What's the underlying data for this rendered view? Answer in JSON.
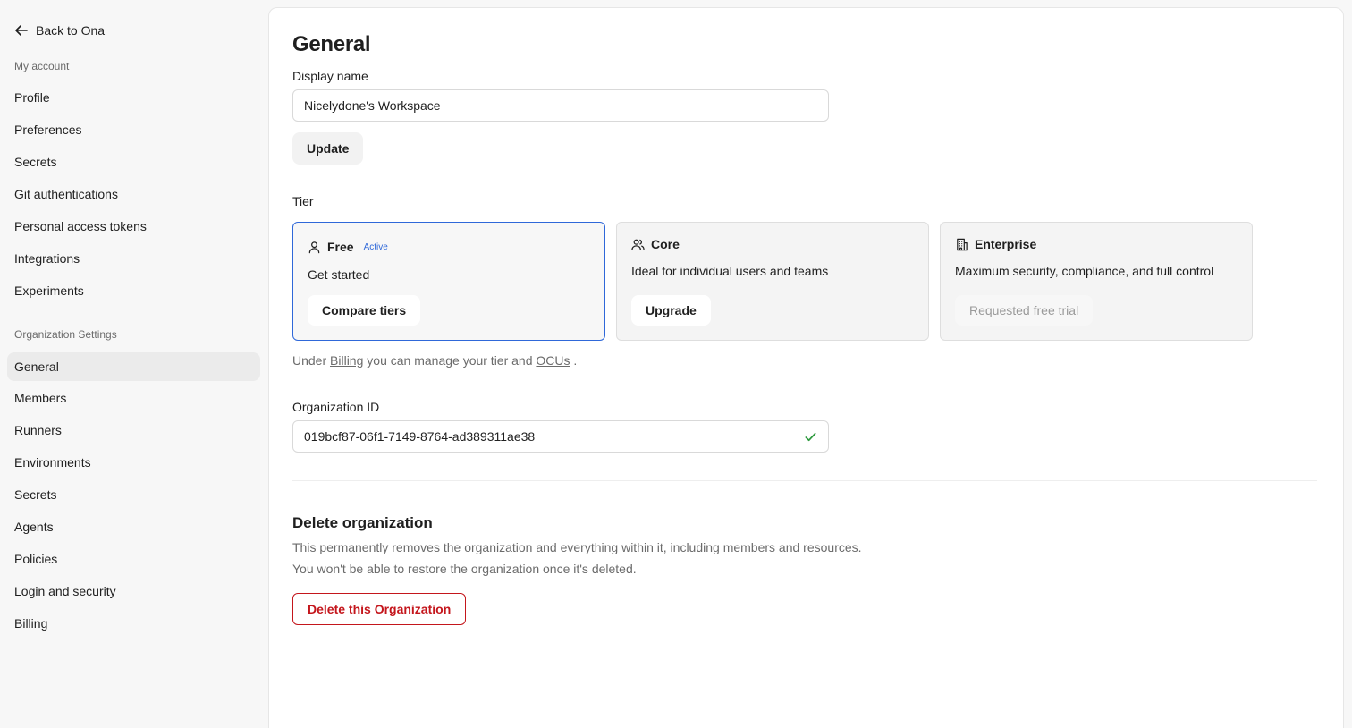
{
  "sidebar": {
    "back_label": "Back to Ona",
    "my_account_label": "My account",
    "my_account_items": [
      {
        "label": "Profile"
      },
      {
        "label": "Preferences"
      },
      {
        "label": "Secrets"
      },
      {
        "label": "Git authentications"
      },
      {
        "label": "Personal access tokens"
      },
      {
        "label": "Integrations"
      },
      {
        "label": "Experiments"
      }
    ],
    "org_settings_label": "Organization Settings",
    "org_items": [
      {
        "label": "General",
        "active": true
      },
      {
        "label": "Members"
      },
      {
        "label": "Runners"
      },
      {
        "label": "Environments"
      },
      {
        "label": "Secrets"
      },
      {
        "label": "Agents"
      },
      {
        "label": "Policies"
      },
      {
        "label": "Login and security"
      },
      {
        "label": "Billing"
      }
    ]
  },
  "main": {
    "title": "General",
    "display_name_label": "Display name",
    "display_name_value": "Nicelydone's Workspace",
    "update_label": "Update",
    "tier_label": "Tier",
    "tiers": [
      {
        "name": "Free",
        "badge": "Active",
        "description": "Get started",
        "button": "Compare tiers",
        "icon": "user-icon"
      },
      {
        "name": "Core",
        "description": "Ideal for individual users and teams",
        "button": "Upgrade",
        "icon": "users-icon"
      },
      {
        "name": "Enterprise",
        "description": "Maximum security, compliance, and full control",
        "button": "Requested free trial",
        "icon": "building-icon"
      }
    ],
    "hint_prefix": "Under",
    "hint_billing_link": "Billing",
    "hint_middle": "you can manage your tier and",
    "hint_ocus_link": "OCUs",
    "hint_suffix": ".",
    "org_id_label": "Organization ID",
    "org_id_value": "019bcf87-06f1-7149-8764-ad389311ae38",
    "delete_title": "Delete organization",
    "delete_desc_1": "This permanently removes the organization and everything within it, including members and resources.",
    "delete_desc_2": "You won't be able to restore the organization once it's deleted.",
    "delete_button": "Delete this Organization"
  },
  "colors": {
    "accent_blue": "#2f68d9",
    "danger_red": "#c4161c",
    "success_green": "#2e9a3e"
  }
}
